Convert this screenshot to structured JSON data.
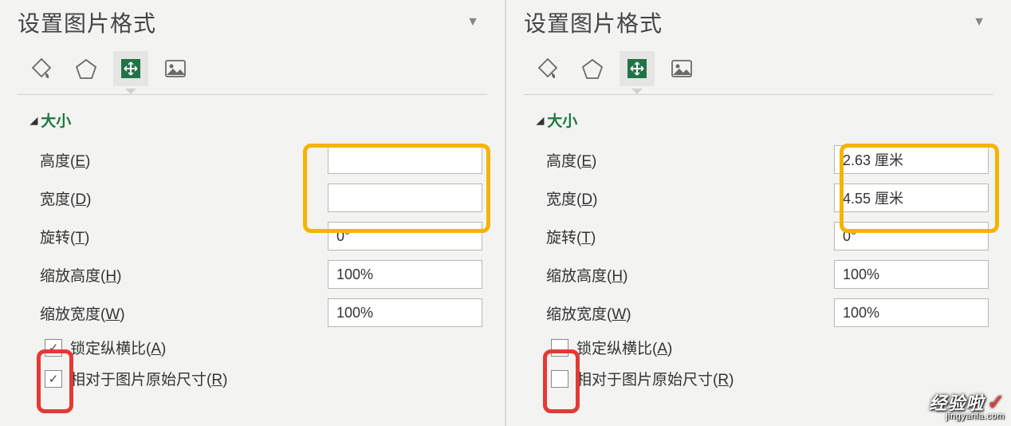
{
  "left": {
    "title": "设置图片格式",
    "section": "大小",
    "fields": {
      "height_label": "高度(E)",
      "height_value": "",
      "width_label": "宽度(D)",
      "width_value": "",
      "rotation_label": "旋转(T)",
      "rotation_value": "0°",
      "scaleH_label": "缩放高度(H)",
      "scaleH_value": "100%",
      "scaleW_label": "缩放宽度(W)",
      "scaleW_value": "100%",
      "lock_aspect_label": "锁定纵横比(A)",
      "lock_aspect_checked": true,
      "relative_orig_label": "相对于图片原始尺寸(R)",
      "relative_orig_checked": true
    }
  },
  "right": {
    "title": "设置图片格式",
    "section": "大小",
    "fields": {
      "height_label": "高度(E)",
      "height_value": "2.63 厘米",
      "width_label": "宽度(D)",
      "width_value": "4.55 厘米",
      "rotation_label": "旋转(T)",
      "rotation_value": "0°",
      "scaleH_label": "缩放高度(H)",
      "scaleH_value": "100%",
      "scaleW_label": "缩放宽度(W)",
      "scaleW_value": "100%",
      "lock_aspect_label": "锁定纵横比(A)",
      "lock_aspect_checked": false,
      "relative_orig_label": "相对于图片原始尺寸(R)",
      "relative_orig_checked": false
    }
  },
  "watermark": {
    "name": "经验啦",
    "url": "jingyanla.com"
  },
  "colors": {
    "accent_green": "#1c7a3c",
    "tab_selected_icon_bg": "#217346",
    "hl_orange": "#f4b400",
    "hl_red": "#e53935"
  }
}
